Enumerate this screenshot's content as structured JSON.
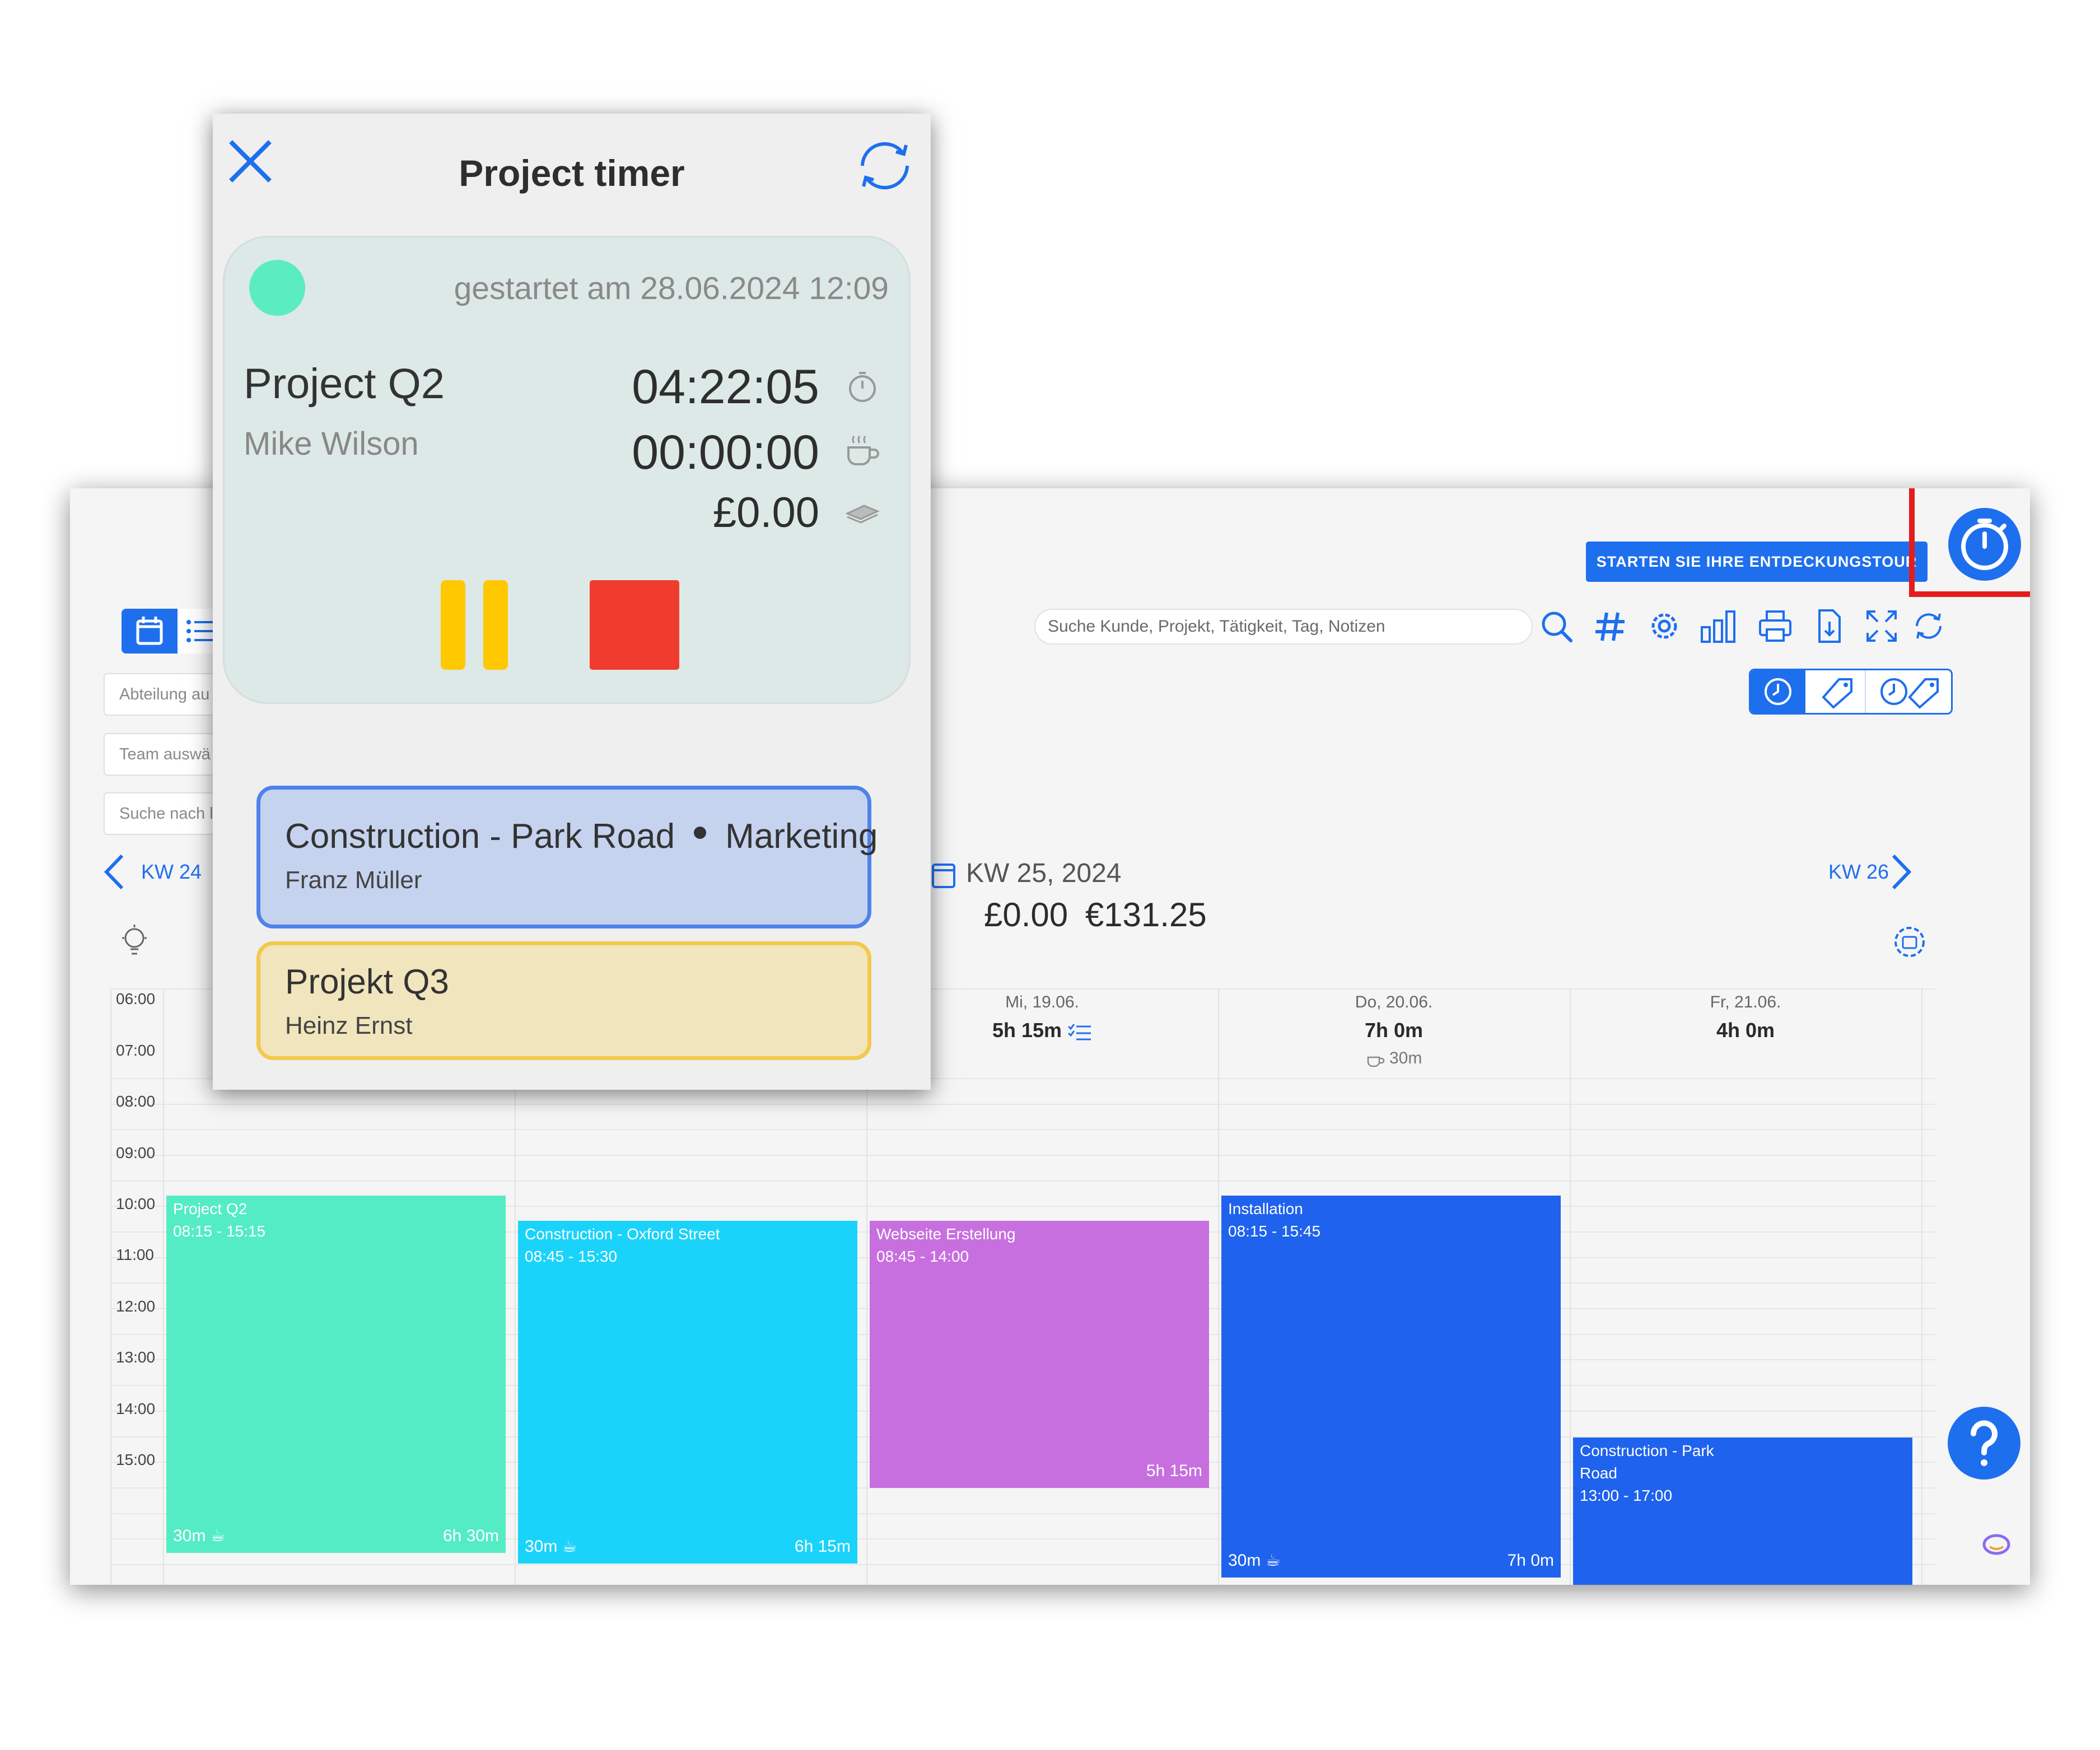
{
  "app": {
    "tour_button": "STARTEN SIE IHRE ENTDECKUNGSTOUR",
    "search_placeholder": "Suche Kunde, Projekt, Tätigkeit, Tag, Notizen",
    "filters": [
      "Abteilung au",
      "Team auswä",
      "Suche nach l"
    ],
    "prev_week": "KW 24",
    "next_week": "KW 26",
    "week_title": "KW 25, 2024",
    "week_totals": "£0.00 €131.25",
    "hours": [
      "06:00",
      "07:00",
      "08:00",
      "09:00",
      "10:00",
      "11:00",
      "12:00",
      "13:00",
      "14:00",
      "15:00"
    ],
    "days": [
      {
        "date": "Mi, 19.06.",
        "total": "5h 15m",
        "break": ""
      },
      {
        "date": "Do, 20.06.",
        "total": "7h 0m",
        "break": "30m"
      },
      {
        "date": "Fr, 21.06.",
        "total": "4h 0m",
        "break": ""
      }
    ],
    "events": [
      {
        "title": "Project Q2",
        "time": "08:15 - 15:15",
        "break": "30m",
        "duration": "6h 30m",
        "color": "#54ecc5"
      },
      {
        "title": "Construction - Oxford Street",
        "time": "08:45 - 15:30",
        "break": "30m",
        "duration": "6h 15m",
        "color": "#1ad3fa"
      },
      {
        "title": "Webseite Erstellung",
        "time": "08:45 - 14:00",
        "break": "",
        "duration": "5h 15m",
        "color": "#c76fde"
      },
      {
        "title": "Installation",
        "time": "08:15 - 15:45",
        "break": "30m",
        "duration": "7h 0m",
        "color": "#1f62ed"
      },
      {
        "title": "Construction - Park Road",
        "time": "13:00 - 17:00",
        "break": "",
        "duration": "",
        "color": "#1f62ed"
      }
    ],
    "accent": "#1e6fee"
  },
  "popup": {
    "title": "Project timer",
    "started": "gestartet am 28.06.2024 12:09",
    "project": "Project Q2",
    "person": "Mike Wilson",
    "work_time": "04:22:05",
    "break_time": "00:00:00",
    "amount": "£0.00",
    "other_timers": [
      {
        "project": "Construction - Park Road",
        "tag": "Marketing",
        "person": "Franz Müller"
      },
      {
        "project": "Projekt Q3",
        "tag": "",
        "person": "Heinz Ernst"
      }
    ]
  },
  "icons": [
    "close-icon",
    "refresh-icon",
    "stopwatch-icon",
    "coffee-icon",
    "money-icon",
    "search-icon",
    "hashtag-icon",
    "gear-icon",
    "chart-icon",
    "printer-icon",
    "export-icon",
    "fullscreen-icon",
    "sync-icon",
    "calendar-icon",
    "list-icon",
    "clock-icon",
    "tag-icon",
    "lightbulb-icon",
    "help-icon"
  ]
}
